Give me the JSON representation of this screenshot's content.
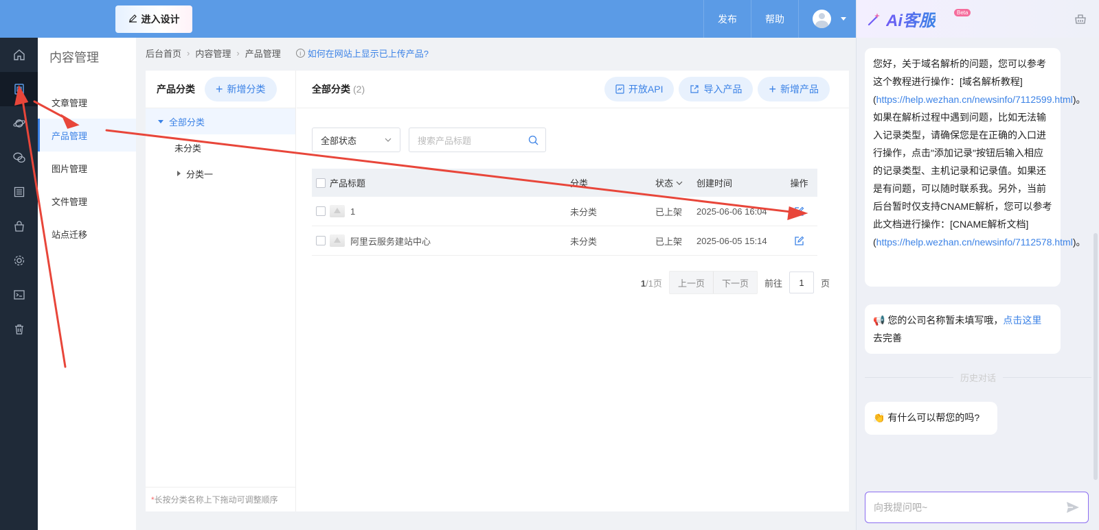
{
  "topbar": {
    "design_btn": "进入设计",
    "publish": "发布",
    "help": "帮助"
  },
  "iconbar": [
    "home-icon",
    "document-icon",
    "planet-icon",
    "wechat-icon",
    "list-icon",
    "bag-icon",
    "gear-icon",
    "terminal-icon",
    "trash-icon"
  ],
  "subnav": {
    "title": "内容管理",
    "items": [
      "文章管理",
      "产品管理",
      "图片管理",
      "文件管理",
      "站点迁移"
    ]
  },
  "breadcrumb": {
    "items": [
      "后台首页",
      "内容管理",
      "产品管理"
    ],
    "help": "如何在网站上显示已上传产品?"
  },
  "category": {
    "title": "产品分类",
    "add": "新增分类",
    "tree": [
      "全部分类",
      "未分类",
      "分类一"
    ],
    "footer_star": "*",
    "footer": "长按分类名称上下拖动可调整顺序"
  },
  "main": {
    "title": "全部分类",
    "count": "(2)",
    "btn_api": "开放API",
    "btn_import": "导入产品",
    "btn_add": "新增产品",
    "status_select": "全部状态",
    "search_placeholder": "搜索产品标题",
    "columns": [
      "产品标题",
      "分类",
      "状态",
      "创建时间",
      "操作"
    ],
    "rows": [
      {
        "title": "1",
        "cat": "未分类",
        "status": "已上架",
        "time": "2025-06-06 16:04"
      },
      {
        "title": "阿里云服务建站中心",
        "cat": "未分类",
        "status": "已上架",
        "time": "2025-06-05 15:14"
      }
    ],
    "pager": {
      "current": "1",
      "total": "/1页",
      "prev": "上一页",
      "next": "下一页",
      "goto": "前往",
      "page_value": "1",
      "page_unit": "页"
    }
  },
  "ai": {
    "logo": "Ai客服",
    "beta": "Beta",
    "msg1_a": "您好，关于域名解析的问题，您可以参考这个教程进行操作：[域名解析教程](",
    "msg1_link1": "https://help.wezhan.cn/newsinfo/7112599.html",
    "msg1_b": ")。如果在解析过程中遇到问题，比如无法输入记录类型，请确保您是在正确的入口进行操作，点击\"添加记录\"按钮后输入相应的记录类型、主机记录和记录值。如果还是有问题，可以随时联系我。另外，当前后台暂时仅支持CNAME解析，您可以参考此文档进行操作：[CNAME解析文档](",
    "msg1_link2": "https://help.wezhan.cn/newsinfo/7112578.html",
    "msg1_c": ")。",
    "msg2_icon": "📢",
    "msg2_a": "您的公司名称暂未填写哦，",
    "msg2_link": "点击这里",
    "msg2_b": "去完善",
    "history": "历史对话",
    "msg3_icon": "👏",
    "msg3": "有什么可以帮您的吗?",
    "input_placeholder": "向我提问吧~"
  },
  "colors": {
    "topbar": "#5b9be6",
    "accent": "#3b82e6",
    "sidebar": "#1f2a38",
    "annotation": "#e8463a"
  }
}
